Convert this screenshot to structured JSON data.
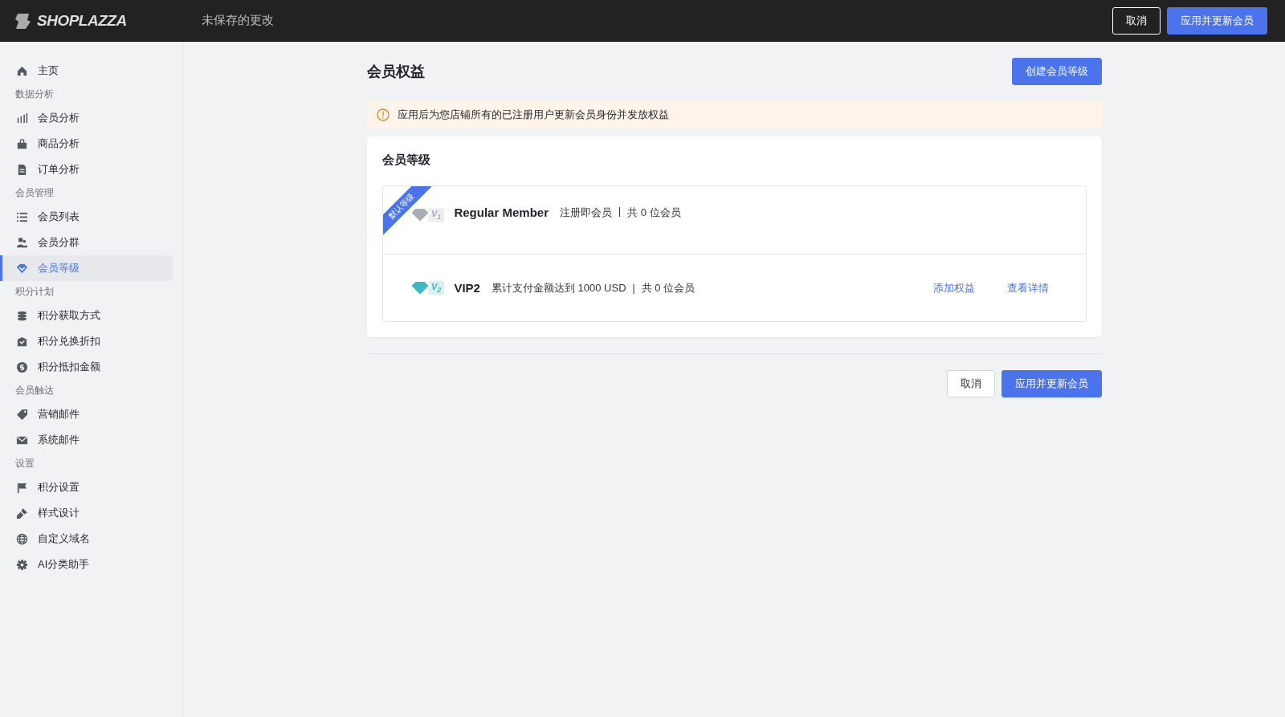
{
  "topbar": {
    "logo": "SHOPLAZZA",
    "status": "未保存的更改",
    "buttons": [
      {
        "label": "取消",
        "kind": "secondary"
      },
      {
        "label": "应用并更新会员",
        "kind": "primary"
      }
    ]
  },
  "sidebar": [
    {
      "items": [
        {
          "label": "主页",
          "selected": false
        }
      ]
    },
    {
      "heading": "数据分析",
      "items": [
        {
          "label": "会员分析",
          "selected": false
        },
        {
          "label": "商品分析",
          "selected": false
        },
        {
          "label": "订单分析",
          "selected": false
        }
      ]
    },
    {
      "heading": "会员管理",
      "items": [
        {
          "label": "会员列表",
          "selected": false
        },
        {
          "label": "会员分群",
          "selected": false
        },
        {
          "label": "会员等级",
          "selected": true
        }
      ]
    },
    {
      "heading": "积分计划",
      "items": [
        {
          "label": "积分获取方式",
          "selected": false
        },
        {
          "label": "积分兑换折扣",
          "selected": false
        },
        {
          "label": "积分抵扣金额",
          "selected": false
        }
      ]
    },
    {
      "heading": "会员触达",
      "items": [
        {
          "label": "营销邮件",
          "selected": false
        },
        {
          "label": "系统邮件",
          "selected": false
        }
      ]
    },
    {
      "heading": "设置",
      "items": [
        {
          "label": "积分设置",
          "selected": false
        },
        {
          "label": "样式设计",
          "selected": false
        },
        {
          "label": "自定义域名",
          "selected": false
        },
        {
          "label": "AI分类助手",
          "selected": false
        }
      ]
    }
  ],
  "page": {
    "title": "会员权益",
    "create_button": "创建会员等级",
    "notice": "应用后为您店铺所有的已注册用户更新会员身份并发放权益",
    "card": {
      "title": "会员等级",
      "tiers": [
        {
          "ribbon": "默认等级",
          "badge": "V$_{1}$",
          "color": "#a9adb6",
          "name": "Regular Member",
          "condition": "注册即会员",
          "separator": "|",
          "count": "共 0 位会员"
        },
        {
          "badge": "V$_{2}$",
          "color": "#3fb8c4",
          "name": "VIP2",
          "condition": "累计支付金额达到 1000 USD",
          "separator": "|",
          "count": "共 0 位会员",
          "actions": [
            "添加权益",
            "查看详情"
          ]
        }
      ]
    },
    "footer_buttons": [
      {
        "label": "取消",
        "kind": "secondary"
      },
      {
        "label": "应用并更新会员",
        "kind": "primary"
      }
    ]
  }
}
